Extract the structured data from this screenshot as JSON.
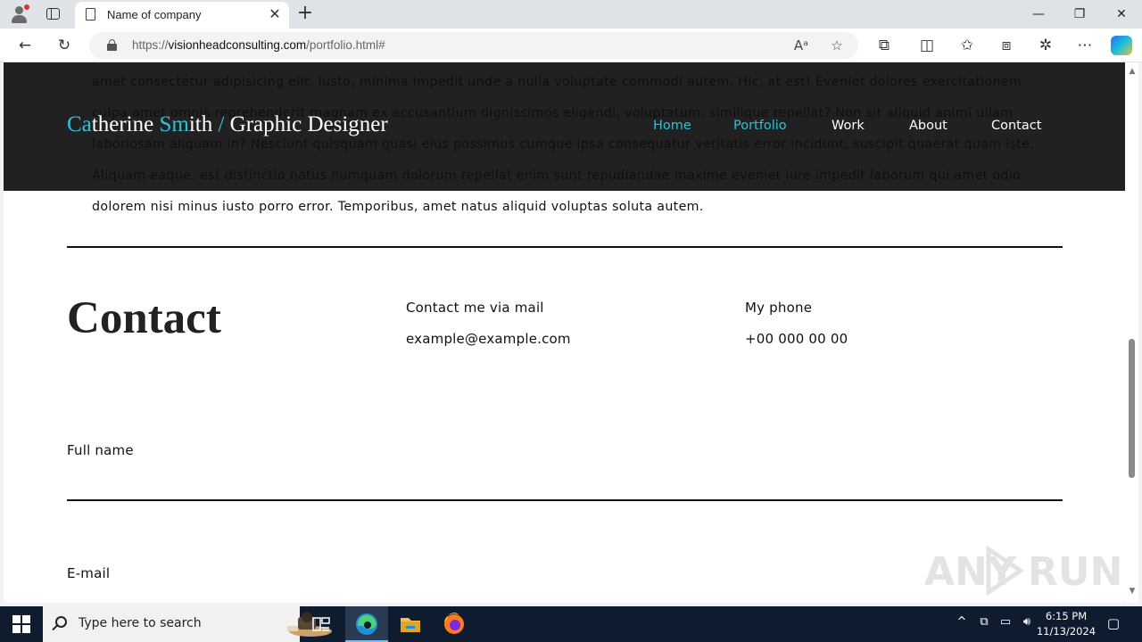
{
  "browser": {
    "tab_title": "Name of company",
    "tab_close": "✕",
    "new_tab": "+",
    "url_scheme": "https://",
    "url_host": "visionheadconsulting.com",
    "url_path": "/portfolio.html#",
    "read_aloud": "Aᵃ",
    "favorite": "☆",
    "minimize": "—",
    "restore": "❐",
    "close": "✕",
    "back": "←",
    "refresh": "↻",
    "extensions": "⧉",
    "split": "◫",
    "favorites": "✩",
    "collections": "⧈",
    "performance": "✲",
    "more": "⋯"
  },
  "page": {
    "paragraph": "amet consectetur adipisicing elit. Iusto, minima impedit unde a nulla voluptate commodi autem. Hic, at est! Eveniet dolores exercitationem culpa amet omnis reprehenderit magnam ex accusantium dignissimos eligendi, voluptatum, similique repellat? Non sit aliquid animi ullam laboriosam aliquam in? Nesciunt quisquam quasi eius possimus cumque ipsa consequatur veritatis error incidunt, suscipit quaerat quam iste. Aliquam eaque, est distinctio natus numquam dolorum repellat enim sunt repudiandae maxime eveniet iure impedit laborum qui amet odio dolorem nisi minus iusto porro error. Temporibus, amet natus aliquid voluptas soluta autem.",
    "brand": {
      "part1_hl": "Ca",
      "part2": "therine ",
      "part3_hl": "Sm",
      "part4": "ith ",
      "part5_hl": "/ ",
      "part6": "Graphic Designer"
    },
    "nav": {
      "home": "Home",
      "portfolio": "Portfolio",
      "work": "Work",
      "about": "About",
      "contact": "Contact"
    },
    "contact": {
      "heading": "Contact",
      "mail_label": "Contact me via mail",
      "mail_value": "example@example.com",
      "phone_label": "My phone",
      "phone_value": "+00 000 00 00"
    },
    "form": {
      "fullname_label": "Full name",
      "email_label": "E-mail"
    },
    "watermark_a": "ANY",
    "watermark_b": "RUN"
  },
  "taskbar": {
    "search_placeholder": "Type here to search",
    "time": "6:15 PM",
    "date": "11/13/2024",
    "tray_up": "^",
    "tray_display": "⧉",
    "tray_network": "▭",
    "tray_sound": "🔊︎",
    "notifications": "▢"
  },
  "colors": {
    "accent": "#2bc2d6",
    "navbar_bg": "#0e0e0e",
    "taskbar_bg": "#0f1b2e"
  }
}
